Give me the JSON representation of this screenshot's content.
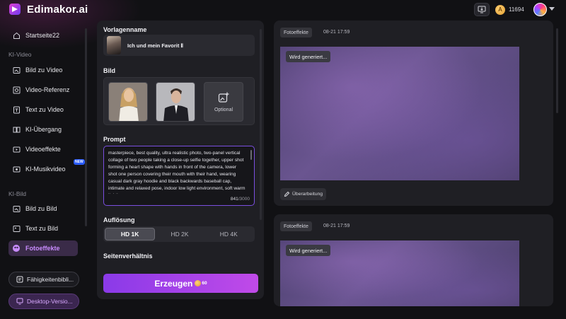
{
  "app": {
    "title": "Edimakor.ai",
    "coins": "11694"
  },
  "sidebar": {
    "home": "Startseite22",
    "section_video": "KI-Video",
    "video_items": [
      "Bild zu Video",
      "Video-Referenz",
      "Text zu Video",
      "KI-Übergang",
      "Videoeffekte",
      "KI-Musikvideo"
    ],
    "new_badge": "NEW",
    "section_image": "KI-Bild",
    "image_items": [
      "Bild zu Bild",
      "Text zu Bild",
      "Fotoeffekte"
    ],
    "skills_button": "Fähigkeitenbibli...",
    "desktop_button": "Desktop-Versio..."
  },
  "form": {
    "template_label": "Vorlagenname",
    "template_name": "Ich und mein Favorit Ⅱ",
    "image_label": "Bild",
    "optional_label": "Optional",
    "prompt_label": "Prompt",
    "prompt_text": "masterpiece, best quality, ultra realistic photo, two-panel vertical collage of two people taking a close-up selfie together, upper shot forming a heart shape with hands in front of the camera, lower shot one person covering their mouth with their hand, wearing casual dark gray hoodie and black backwards baseball cap, intimate and relaxed pose, indoor low light environment, soft warm lighting,",
    "prompt_count": "841",
    "prompt_max": "/3000",
    "resolution_label": "Auflösung",
    "resolutions": [
      "HD 1K",
      "HD 2K",
      "HD 4K"
    ],
    "resolution_selected": "HD 1K",
    "aspect_label": "Seitenverhältnis",
    "generate_label": "Erzeugen",
    "generate_cost": "60"
  },
  "results": [
    {
      "tag": "Fotoeffekte",
      "date": "08-21 17:59",
      "status": "Wird generiert...",
      "edit_label": "Überarbeitung"
    },
    {
      "tag": "Fotoeffekte",
      "date": "08-21 17:59",
      "status": "Wird generiert..."
    }
  ],
  "colors": {
    "accent": "#a24ae8",
    "active_sidebar_text": "#c98cff",
    "prompt_border": "#7b4fe0"
  }
}
